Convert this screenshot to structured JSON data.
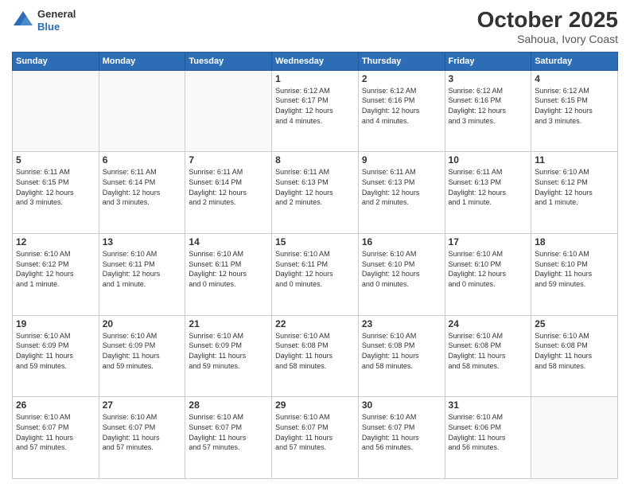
{
  "header": {
    "logo_line1": "General",
    "logo_line2": "Blue",
    "month": "October 2025",
    "location": "Sahoua, Ivory Coast"
  },
  "weekdays": [
    "Sunday",
    "Monday",
    "Tuesday",
    "Wednesday",
    "Thursday",
    "Friday",
    "Saturday"
  ],
  "weeks": [
    [
      {
        "day": "",
        "info": ""
      },
      {
        "day": "",
        "info": ""
      },
      {
        "day": "",
        "info": ""
      },
      {
        "day": "1",
        "info": "Sunrise: 6:12 AM\nSunset: 6:17 PM\nDaylight: 12 hours\nand 4 minutes."
      },
      {
        "day": "2",
        "info": "Sunrise: 6:12 AM\nSunset: 6:16 PM\nDaylight: 12 hours\nand 4 minutes."
      },
      {
        "day": "3",
        "info": "Sunrise: 6:12 AM\nSunset: 6:16 PM\nDaylight: 12 hours\nand 3 minutes."
      },
      {
        "day": "4",
        "info": "Sunrise: 6:12 AM\nSunset: 6:15 PM\nDaylight: 12 hours\nand 3 minutes."
      }
    ],
    [
      {
        "day": "5",
        "info": "Sunrise: 6:11 AM\nSunset: 6:15 PM\nDaylight: 12 hours\nand 3 minutes."
      },
      {
        "day": "6",
        "info": "Sunrise: 6:11 AM\nSunset: 6:14 PM\nDaylight: 12 hours\nand 3 minutes."
      },
      {
        "day": "7",
        "info": "Sunrise: 6:11 AM\nSunset: 6:14 PM\nDaylight: 12 hours\nand 2 minutes."
      },
      {
        "day": "8",
        "info": "Sunrise: 6:11 AM\nSunset: 6:13 PM\nDaylight: 12 hours\nand 2 minutes."
      },
      {
        "day": "9",
        "info": "Sunrise: 6:11 AM\nSunset: 6:13 PM\nDaylight: 12 hours\nand 2 minutes."
      },
      {
        "day": "10",
        "info": "Sunrise: 6:11 AM\nSunset: 6:13 PM\nDaylight: 12 hours\nand 1 minute."
      },
      {
        "day": "11",
        "info": "Sunrise: 6:10 AM\nSunset: 6:12 PM\nDaylight: 12 hours\nand 1 minute."
      }
    ],
    [
      {
        "day": "12",
        "info": "Sunrise: 6:10 AM\nSunset: 6:12 PM\nDaylight: 12 hours\nand 1 minute."
      },
      {
        "day": "13",
        "info": "Sunrise: 6:10 AM\nSunset: 6:11 PM\nDaylight: 12 hours\nand 1 minute."
      },
      {
        "day": "14",
        "info": "Sunrise: 6:10 AM\nSunset: 6:11 PM\nDaylight: 12 hours\nand 0 minutes."
      },
      {
        "day": "15",
        "info": "Sunrise: 6:10 AM\nSunset: 6:11 PM\nDaylight: 12 hours\nand 0 minutes."
      },
      {
        "day": "16",
        "info": "Sunrise: 6:10 AM\nSunset: 6:10 PM\nDaylight: 12 hours\nand 0 minutes."
      },
      {
        "day": "17",
        "info": "Sunrise: 6:10 AM\nSunset: 6:10 PM\nDaylight: 12 hours\nand 0 minutes."
      },
      {
        "day": "18",
        "info": "Sunrise: 6:10 AM\nSunset: 6:10 PM\nDaylight: 11 hours\nand 59 minutes."
      }
    ],
    [
      {
        "day": "19",
        "info": "Sunrise: 6:10 AM\nSunset: 6:09 PM\nDaylight: 11 hours\nand 59 minutes."
      },
      {
        "day": "20",
        "info": "Sunrise: 6:10 AM\nSunset: 6:09 PM\nDaylight: 11 hours\nand 59 minutes."
      },
      {
        "day": "21",
        "info": "Sunrise: 6:10 AM\nSunset: 6:09 PM\nDaylight: 11 hours\nand 59 minutes."
      },
      {
        "day": "22",
        "info": "Sunrise: 6:10 AM\nSunset: 6:08 PM\nDaylight: 11 hours\nand 58 minutes."
      },
      {
        "day": "23",
        "info": "Sunrise: 6:10 AM\nSunset: 6:08 PM\nDaylight: 11 hours\nand 58 minutes."
      },
      {
        "day": "24",
        "info": "Sunrise: 6:10 AM\nSunset: 6:08 PM\nDaylight: 11 hours\nand 58 minutes."
      },
      {
        "day": "25",
        "info": "Sunrise: 6:10 AM\nSunset: 6:08 PM\nDaylight: 11 hours\nand 58 minutes."
      }
    ],
    [
      {
        "day": "26",
        "info": "Sunrise: 6:10 AM\nSunset: 6:07 PM\nDaylight: 11 hours\nand 57 minutes."
      },
      {
        "day": "27",
        "info": "Sunrise: 6:10 AM\nSunset: 6:07 PM\nDaylight: 11 hours\nand 57 minutes."
      },
      {
        "day": "28",
        "info": "Sunrise: 6:10 AM\nSunset: 6:07 PM\nDaylight: 11 hours\nand 57 minutes."
      },
      {
        "day": "29",
        "info": "Sunrise: 6:10 AM\nSunset: 6:07 PM\nDaylight: 11 hours\nand 57 minutes."
      },
      {
        "day": "30",
        "info": "Sunrise: 6:10 AM\nSunset: 6:07 PM\nDaylight: 11 hours\nand 56 minutes."
      },
      {
        "day": "31",
        "info": "Sunrise: 6:10 AM\nSunset: 6:06 PM\nDaylight: 11 hours\nand 56 minutes."
      },
      {
        "day": "",
        "info": ""
      }
    ]
  ]
}
